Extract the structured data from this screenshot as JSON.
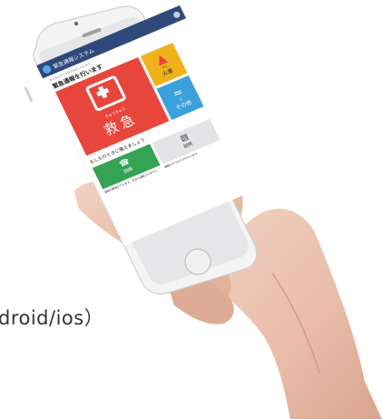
{
  "caption": {
    "platforms": "droid/ios）"
  },
  "app": {
    "title": "緊急通報システム",
    "prompt_small": "きんきゅうつうほうをおこないます",
    "prompt": "緊急通報を行います",
    "emergency_ruby": "きゅうきゅう",
    "emergency_label": "救急",
    "fire_ruby": "かじ",
    "fire_label": "火事",
    "other_ruby": "た",
    "other_label": "その他",
    "practice_prompt": "もしものときに備えましょう",
    "training_label": "訓練",
    "training_desc": "通報の練習ができます。本当の通報されません",
    "guide_label": "説明",
    "guide_desc": "通報のやりかたがわかります"
  },
  "colors": {
    "header": "#2f4a7a",
    "emergency": "#e8463c",
    "fire": "#f0b21c",
    "other": "#3aa1dc",
    "training": "#34a353",
    "guide": "#e3e4e6"
  }
}
